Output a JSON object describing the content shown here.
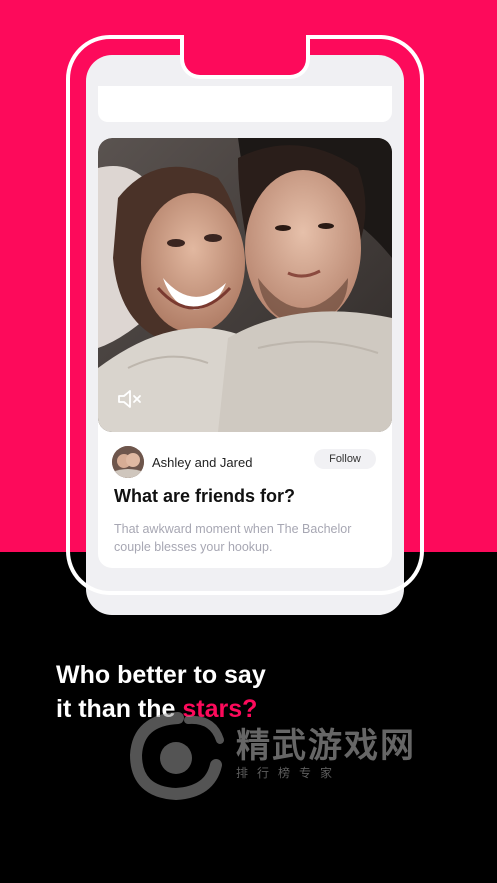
{
  "card": {
    "author_name": "Ashley and Jared",
    "follow_label": "Follow",
    "title": "What are friends for?",
    "description": "That awkward moment when The Bachelor couple blesses your hookup."
  },
  "tagline": {
    "line1": "Who better to say",
    "line2_prefix": "it than the ",
    "line2_accent": "stars?"
  },
  "watermark": {
    "title": "精武游戏网",
    "subtitle": "排行榜专家"
  },
  "colors": {
    "brand_pink": "#fd0a5b",
    "background_dark": "#000000",
    "card_bg": "#ffffff"
  },
  "icons": {
    "mute": "speaker-muted-icon"
  }
}
